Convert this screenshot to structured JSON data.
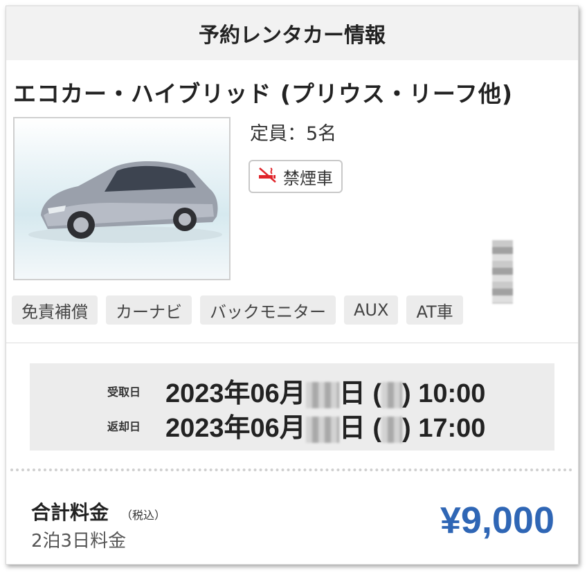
{
  "header": {
    "title": "予約レンタカー情報"
  },
  "vehicle": {
    "class_name": "エコカー・ハイブリッド (プリウス・リーフ他)",
    "capacity": "定員：5名",
    "smoking_badge": "禁煙車",
    "smoking_icon": "no-smoking-icon",
    "photo": "silver-hybrid-car-photo"
  },
  "options": [
    "免責補償",
    "カーナビ",
    "バックモニター",
    "AUX",
    "AT車"
  ],
  "schedule": {
    "pickup": {
      "label": "受取日",
      "date_prefix": "2023年06月",
      "date_suffix": "日 (",
      "time": ") 10:00"
    },
    "return": {
      "label": "返却日",
      "date_prefix": "2023年06月",
      "date_suffix": "日 (",
      "time": ") 17:00"
    }
  },
  "total": {
    "label": "合計料金",
    "tax_note": "（税込）",
    "stay": "2泊3日料金",
    "price": "¥9,000"
  },
  "colors": {
    "price": "#2f66b5",
    "badge_icon": "#e0242a",
    "header_bg": "#f2f2f2"
  }
}
